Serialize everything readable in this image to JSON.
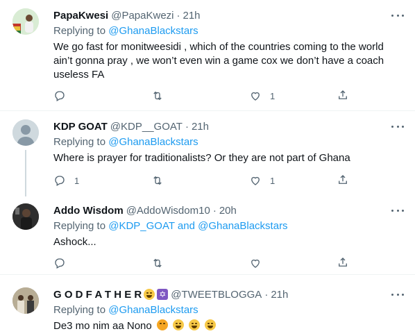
{
  "tweets": [
    {
      "name": "PapaKwesi",
      "handle": "@PapaKwezi",
      "time": "21h",
      "replying_prefix": "Replying to",
      "replying_to": "@GhanaBlackstars",
      "text": "We go  fast for monitweesidi , which of the countries coming to the world ain’t gonna pray , we won’t even win a game cox we don’t have a coach useless FA",
      "reply_count": "",
      "retweet_count": "",
      "like_count": "1"
    },
    {
      "name": "KDP GOAT",
      "handle": "@KDP__GOAT",
      "time": "21h",
      "replying_prefix": "Replying to",
      "replying_to": "@GhanaBlackstars",
      "text": "Where is prayer for traditionalists? Or they are not part of Ghana",
      "reply_count": "1",
      "retweet_count": "",
      "like_count": "1"
    },
    {
      "name": "Addo Wisdom",
      "handle": "@AddoWisdom10",
      "time": "20h",
      "replying_prefix": "Replying to",
      "replying_to": "@KDP_GOAT and @GhanaBlackstars",
      "text": "Ashock...",
      "reply_count": "",
      "retweet_count": "",
      "like_count": ""
    },
    {
      "name": "G O D F A T H E R",
      "handle": "@TWEETBLOGGA",
      "time": "21h",
      "replying_prefix": "Replying to",
      "replying_to": "@GhanaBlackstars",
      "text": "De3 mo nim aa Nono"
    }
  ],
  "separator": "·",
  "icons": {
    "reply": "reply-icon",
    "retweet": "retweet-icon",
    "like": "like-icon",
    "share": "share-icon",
    "more": "more-icon"
  },
  "colors": {
    "link": "#1d9bf0",
    "secondary_text": "#536471",
    "primary_text": "#0f1419"
  }
}
